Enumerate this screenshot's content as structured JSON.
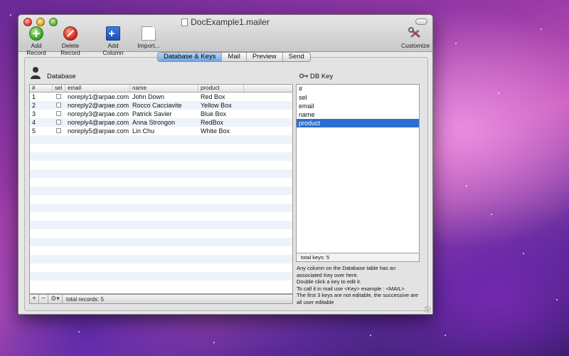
{
  "window": {
    "title": "DocExample1.mailer"
  },
  "toolbar": {
    "add_record": "Add Record",
    "delete_record": "Delete Record",
    "add_column": "Add Column",
    "import": "Import...",
    "customize": "Customize"
  },
  "tabs": [
    {
      "label": "Database & Keys",
      "active": true
    },
    {
      "label": "Mail",
      "active": false
    },
    {
      "label": "Preview",
      "active": false
    },
    {
      "label": "Send",
      "active": false
    }
  ],
  "database": {
    "label": "Database",
    "columns": [
      "#",
      "sel",
      "email",
      "name",
      "product"
    ],
    "rows": [
      {
        "num": "1",
        "email": "noreply1@arpae.com",
        "name": "John Down",
        "product": "Red Box"
      },
      {
        "num": "2",
        "email": "noreply2@arpae.com",
        "name": "Rocco Cacciavite",
        "product": "Yellow Box"
      },
      {
        "num": "3",
        "email": "noreply3@arpae.com",
        "name": "Patrick Savier",
        "product": "Blue Box"
      },
      {
        "num": "4",
        "email": "noreply4@arpae.com",
        "name": "Anna Strongon",
        "product": "RedBox"
      },
      {
        "num": "5",
        "email": "noreply5@arpae.com",
        "name": "Lin Chu",
        "product": "White Box"
      }
    ],
    "footer": {
      "add": "+",
      "remove": "−",
      "total": "total records: 5"
    }
  },
  "keys": {
    "label": "DB Key",
    "items": [
      "#",
      "sel",
      "email",
      "name",
      "product"
    ],
    "selected_index": 4,
    "total": "total keys: 5",
    "help": [
      "Any column on the Database table has an associated Key over here.",
      "Double click a key to edit it.",
      "To call it in mail use <Key> example : <MAIL>",
      "The first 3 keys are not editable, the successive are all user editable"
    ]
  },
  "colors": {
    "selection": "#2a6fd0",
    "active_tab": "#6ea5e3"
  }
}
